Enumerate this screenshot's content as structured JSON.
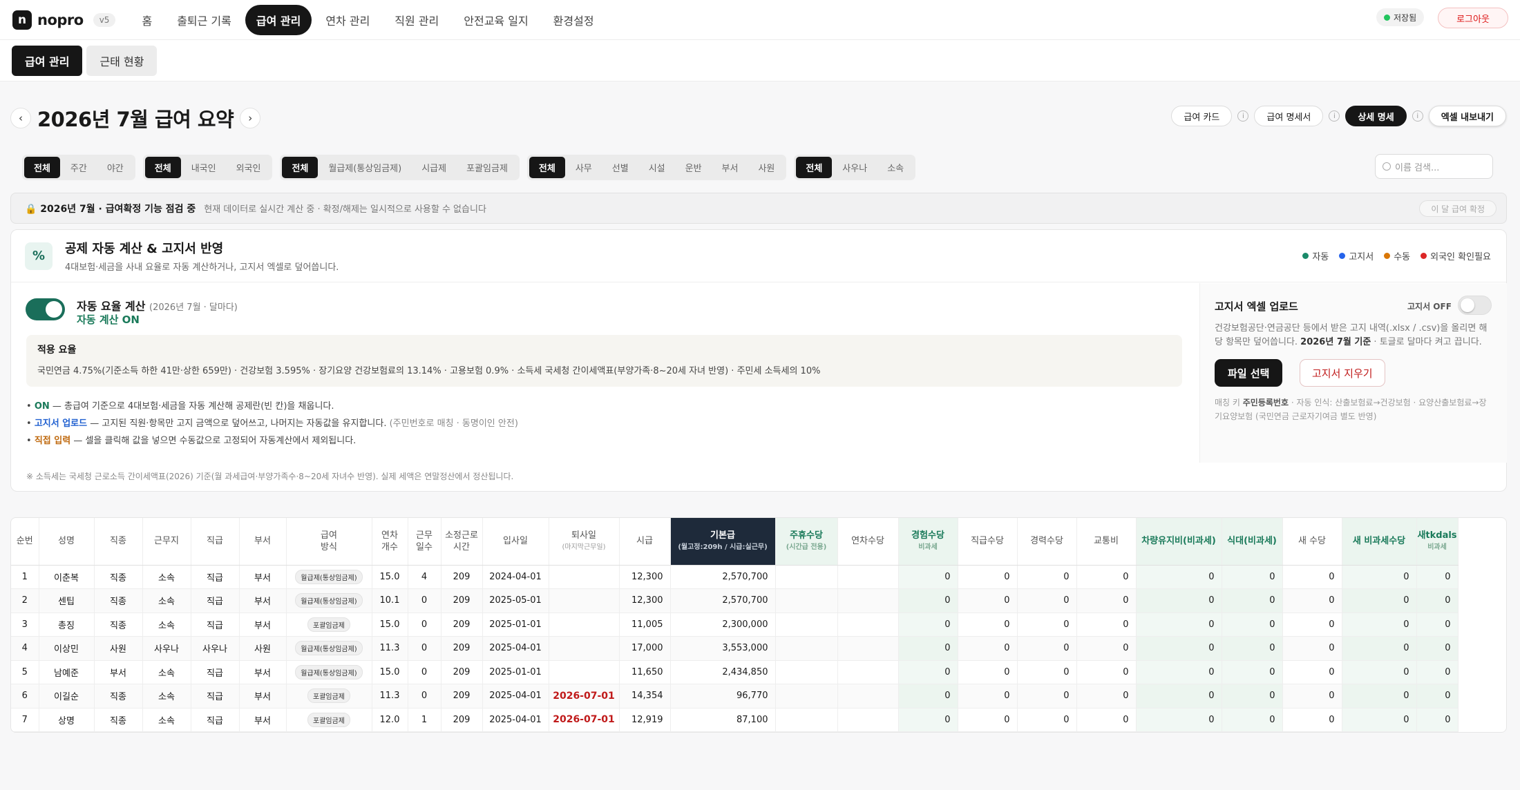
{
  "app": {
    "logo_letter": "n",
    "name": "nopro",
    "version": "v5",
    "saved_label": "저장됨",
    "logout_label": "로그아웃"
  },
  "nav": [
    "홈",
    "출퇴근 기록",
    "급여 관리",
    "연차 관리",
    "직원 관리",
    "안전교육 일지",
    "환경설정"
  ],
  "nav_active_index": 2,
  "subtabs": [
    "급여 관리",
    "근태 현황"
  ],
  "page": {
    "prev": "‹",
    "next": "›",
    "title": "2026년 7월 급여 요약"
  },
  "actions": {
    "card": "급여 카드",
    "statement": "급여 명세서",
    "detail": "상세 명세",
    "export": "엑셀 내보내기",
    "info": "i"
  },
  "filters": [
    [
      "전체",
      "주간",
      "야간"
    ],
    [
      "전체",
      "내국인",
      "외국인"
    ],
    [
      "전체",
      "월급제(통상임금제)",
      "시급제",
      "포괄임금제"
    ],
    [
      "전체",
      "사무",
      "선별",
      "시설",
      "운반",
      "부서",
      "사원"
    ],
    [
      "전체",
      "사우나",
      "소속"
    ]
  ],
  "search": {
    "placeholder": "이름 검색..."
  },
  "notice": {
    "title": "🔒 2026년 7월 · 급여확정 기능 점검 중",
    "text": "현재 데이터로 실시간 계산 중 · 확정/해제는 일시적으로 사용할 수 없습니다",
    "button": "이 달 급여 확정"
  },
  "deduction": {
    "icon": "%",
    "title": "공제 자동 계산 & 고지서 반영",
    "subtitle": "4대보험·세금을 사내 요율로 자동 계산하거나, 고지서 엑셀로 덮어씁니다.",
    "legend": [
      {
        "label": "자동",
        "color": "#1a8a6a"
      },
      {
        "label": "고지서",
        "color": "#2563eb"
      },
      {
        "label": "수동",
        "color": "#d97706"
      },
      {
        "label": "외국인 확인필요",
        "color": "#dc2626"
      }
    ],
    "auto_title": "자동 요율 계산",
    "auto_note": "(2026년 7월 · 달마다)",
    "auto_status": "자동 계산 ON",
    "rates_title": "적용 요율",
    "rates_text": "국민연금 4.75%(기준소득 하한 41만·상한 659만) · 건강보험 3.595% · 장기요양 건강보험료의 13.14% · 고용보험 0.9% · 소득세 국세청 간이세액표(부양가족·8~20세 자녀 반영) · 주민세 소득세의 10%",
    "bullets": [
      {
        "key": "ON",
        "text": " — 총급여 기준으로 4대보험·세금을 자동 계산해 공제란(빈 칸)을 채웁니다.",
        "extra": ""
      },
      {
        "key": "고지서 업로드",
        "text": " — 고지된 직원·항목만 고지 금액으로 덮어쓰고, 나머지는 자동값을 유지합니다.",
        "extra": " (주민번호로 매칭 · 동명이인 안전)"
      },
      {
        "key": "직접 입력",
        "text": " — 셀을 클릭해 값을 넣으면 수동값으로 고정되어 자동계산에서 제외됩니다.",
        "extra": ""
      }
    ],
    "upload_title": "고지서 엑셀 업로드",
    "upload_toggle_label": "고지서 OFF",
    "upload_desc_a": "건강보험공단·연금공단 등에서 받은 고지 내역(.xlsx / .csv)을 올리면 해당 항목만 덮어씁니다. ",
    "upload_desc_b": "2026년 7월 기준",
    "upload_desc_c": " · 토글로 달마다 켜고 끕니다.",
    "file_button": "파일 선택",
    "clear_button": "고지서 지우기",
    "match_a": "매칭 키 ",
    "match_b": "주민등록번호",
    "match_c": " · 자동 인식: 산출보험료→건강보험 · 요양산출보험료→장기요양보험 (국민연금 근로자기여금 별도 반영)",
    "footnote": "※ 소득세는 국세청 근로소득 간이세액표(2026) 기준(월 과세급여·부양가족수·8~20세 자녀수 반영). 실제 세액은 연말정산에서 정산됩니다."
  },
  "table": {
    "headers": [
      {
        "l": "순번",
        "s": ""
      },
      {
        "l": "성명",
        "s": ""
      },
      {
        "l": "직종",
        "s": ""
      },
      {
        "l": "근무지",
        "s": ""
      },
      {
        "l": "직급",
        "s": ""
      },
      {
        "l": "부서",
        "s": ""
      },
      {
        "l": "급여\n방식",
        "s": ""
      },
      {
        "l": "연차\n개수",
        "s": ""
      },
      {
        "l": "근무\n일수",
        "s": ""
      },
      {
        "l": "소정근로\n시간",
        "s": ""
      },
      {
        "l": "입사일",
        "s": ""
      },
      {
        "l": "퇴사일",
        "s": "(마지막근무일)"
      },
      {
        "l": "시급",
        "s": ""
      },
      {
        "l": "기본급",
        "s": "(월고정:209h / 시급:실근무)"
      },
      {
        "l": "주휴수당",
        "s": "(시간급 전용)"
      },
      {
        "l": "연차수당",
        "s": ""
      },
      {
        "l": "경험수당",
        "s": "비과세"
      },
      {
        "l": "직급수당",
        "s": ""
      },
      {
        "l": "경력수당",
        "s": ""
      },
      {
        "l": "교통비",
        "s": ""
      },
      {
        "l": "차량유지비(비과세)",
        "s": ""
      },
      {
        "l": "식대(비과세)",
        "s": ""
      },
      {
        "l": "새 수당",
        "s": ""
      },
      {
        "l": "새 비과세수당",
        "s": ""
      },
      {
        "l": "새tkdals",
        "s": "비과세"
      }
    ],
    "rows": [
      [
        "1",
        "이춘복",
        "직종",
        "소속",
        "직급",
        "부서",
        "월급제(통상임금제)",
        "15.0",
        "4",
        "209",
        "2024-04-01",
        "",
        "12,300",
        "2,570,700",
        "",
        "",
        "0",
        "0",
        "0",
        "0",
        "0",
        "0",
        "0",
        "0",
        "0"
      ],
      [
        "2",
        "센팁",
        "직종",
        "소속",
        "직급",
        "부서",
        "월급제(통상임금제)",
        "10.1",
        "0",
        "209",
        "2025-05-01",
        "",
        "12,300",
        "2,570,700",
        "",
        "",
        "0",
        "0",
        "0",
        "0",
        "0",
        "0",
        "0",
        "0",
        "0"
      ],
      [
        "3",
        "총징",
        "직종",
        "소속",
        "직급",
        "부서",
        "포괄임금제",
        "15.0",
        "0",
        "209",
        "2025-01-01",
        "",
        "11,005",
        "2,300,000",
        "",
        "",
        "0",
        "0",
        "0",
        "0",
        "0",
        "0",
        "0",
        "0",
        "0"
      ],
      [
        "4",
        "이상민",
        "사원",
        "사우나",
        "사우나",
        "사원",
        "월급제(통상임금제)",
        "11.3",
        "0",
        "209",
        "2025-04-01",
        "",
        "17,000",
        "3,553,000",
        "",
        "",
        "0",
        "0",
        "0",
        "0",
        "0",
        "0",
        "0",
        "0",
        "0"
      ],
      [
        "5",
        "남예준",
        "부서",
        "소속",
        "직급",
        "부서",
        "월급제(통상임금제)",
        "15.0",
        "0",
        "209",
        "2025-01-01",
        "",
        "11,650",
        "2,434,850",
        "",
        "",
        "0",
        "0",
        "0",
        "0",
        "0",
        "0",
        "0",
        "0",
        "0"
      ],
      [
        "6",
        "이길순",
        "직종",
        "소속",
        "직급",
        "부서",
        "포괄임금제",
        "11.3",
        "0",
        "209",
        "2025-04-01",
        "2026-07-01",
        "14,354",
        "96,770",
        "",
        "",
        "0",
        "0",
        "0",
        "0",
        "0",
        "0",
        "0",
        "0",
        "0"
      ],
      [
        "7",
        "상명",
        "직종",
        "소속",
        "직급",
        "부서",
        "포괄임금제",
        "12.0",
        "1",
        "209",
        "2025-04-01",
        "2026-07-01",
        "12,919",
        "87,100",
        "",
        "",
        "0",
        "0",
        "0",
        "0",
        "0",
        "0",
        "0",
        "0",
        "0"
      ]
    ]
  }
}
